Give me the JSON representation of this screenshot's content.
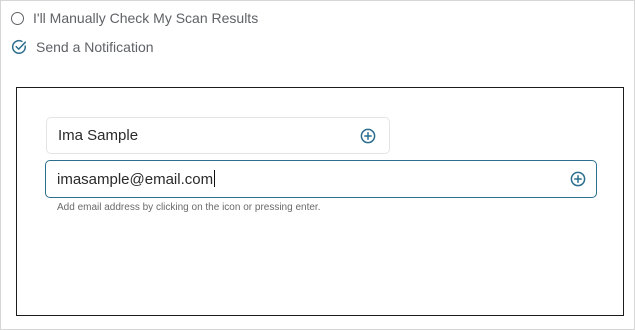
{
  "options": {
    "manual_check": {
      "label": "I'll Manually Check My Scan Results",
      "icon": "radio-unselected-icon",
      "selected": false
    },
    "send_notification": {
      "label": "Send a Notification",
      "icon": "check-circle-icon",
      "selected": true
    }
  },
  "notification_panel": {
    "name_field": {
      "value": "Ima Sample",
      "icon": "plus-circle-icon"
    },
    "email_field": {
      "value": "imasample@email.com",
      "icon": "plus-circle-icon"
    },
    "hint": "Add email address by clicking on the icon or pressing enter."
  },
  "colors": {
    "accent": "#2b6e8e",
    "text_muted": "#5f6266",
    "panel_border": "#1c1c1c"
  }
}
